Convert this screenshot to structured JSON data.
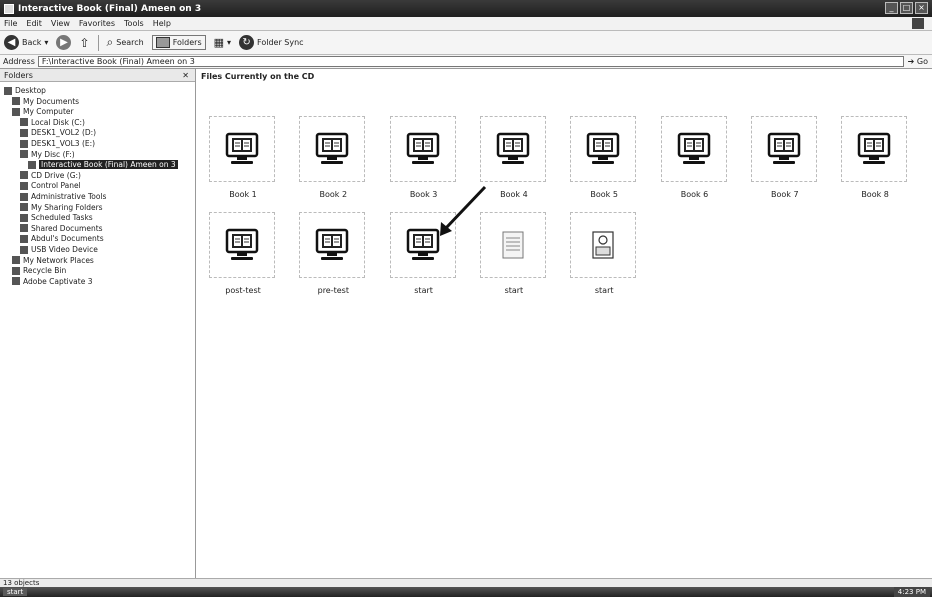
{
  "window": {
    "title": "Interactive Book (Final) Ameen on 3"
  },
  "menu": [
    "File",
    "Edit",
    "View",
    "Favorites",
    "Tools",
    "Help"
  ],
  "toolbar": {
    "back_label": "Back",
    "search_label": "Search",
    "folders_label": "Folders",
    "folder_sync_label": "Folder Sync"
  },
  "address": {
    "label": "Address",
    "value": "F:\\Interactive Book (Final) Ameen on 3",
    "go_label": "Go"
  },
  "folders_pane": {
    "title": "Folders",
    "items": [
      {
        "label": "Desktop",
        "indent": 0
      },
      {
        "label": "My Documents",
        "indent": 1
      },
      {
        "label": "My Computer",
        "indent": 1
      },
      {
        "label": "Local Disk (C:)",
        "indent": 2
      },
      {
        "label": "DESK1_VOL2 (D:)",
        "indent": 2
      },
      {
        "label": "DESK1_VOL3 (E:)",
        "indent": 2
      },
      {
        "label": "My Disc (F:)",
        "indent": 2
      },
      {
        "label": "Interactive Book (Final) Ameen on 3",
        "indent": 3,
        "selected": true
      },
      {
        "label": "CD Drive (G:)",
        "indent": 2
      },
      {
        "label": "Control Panel",
        "indent": 2
      },
      {
        "label": "Administrative Tools",
        "indent": 2
      },
      {
        "label": "My Sharing Folders",
        "indent": 2
      },
      {
        "label": "Scheduled Tasks",
        "indent": 2
      },
      {
        "label": "Shared Documents",
        "indent": 2
      },
      {
        "label": "Abdul's Documents",
        "indent": 2
      },
      {
        "label": "USB Video Device",
        "indent": 2
      },
      {
        "label": "My Network Places",
        "indent": 1
      },
      {
        "label": "Recycle Bin",
        "indent": 1
      },
      {
        "label": "Adobe Captivate 3",
        "indent": 1
      }
    ]
  },
  "content": {
    "header": "Files Currently on the CD",
    "files": [
      {
        "label": "Book 1",
        "type": "book"
      },
      {
        "label": "Book 2",
        "type": "book"
      },
      {
        "label": "Book 3",
        "type": "book"
      },
      {
        "label": "Book 4",
        "type": "book"
      },
      {
        "label": "Book 5",
        "type": "book"
      },
      {
        "label": "Book 6",
        "type": "book"
      },
      {
        "label": "Book 7",
        "type": "book"
      },
      {
        "label": "Book 8",
        "type": "book"
      },
      {
        "label": "post-test",
        "type": "book"
      },
      {
        "label": "pre-test",
        "type": "book"
      },
      {
        "label": "start",
        "type": "book"
      },
      {
        "label": "start",
        "type": "document"
      },
      {
        "label": "start",
        "type": "settings"
      }
    ]
  },
  "statusbar": {
    "text": "13 objects"
  },
  "taskbar": {
    "start_label": "start",
    "tray_time": "4:23 PM"
  }
}
